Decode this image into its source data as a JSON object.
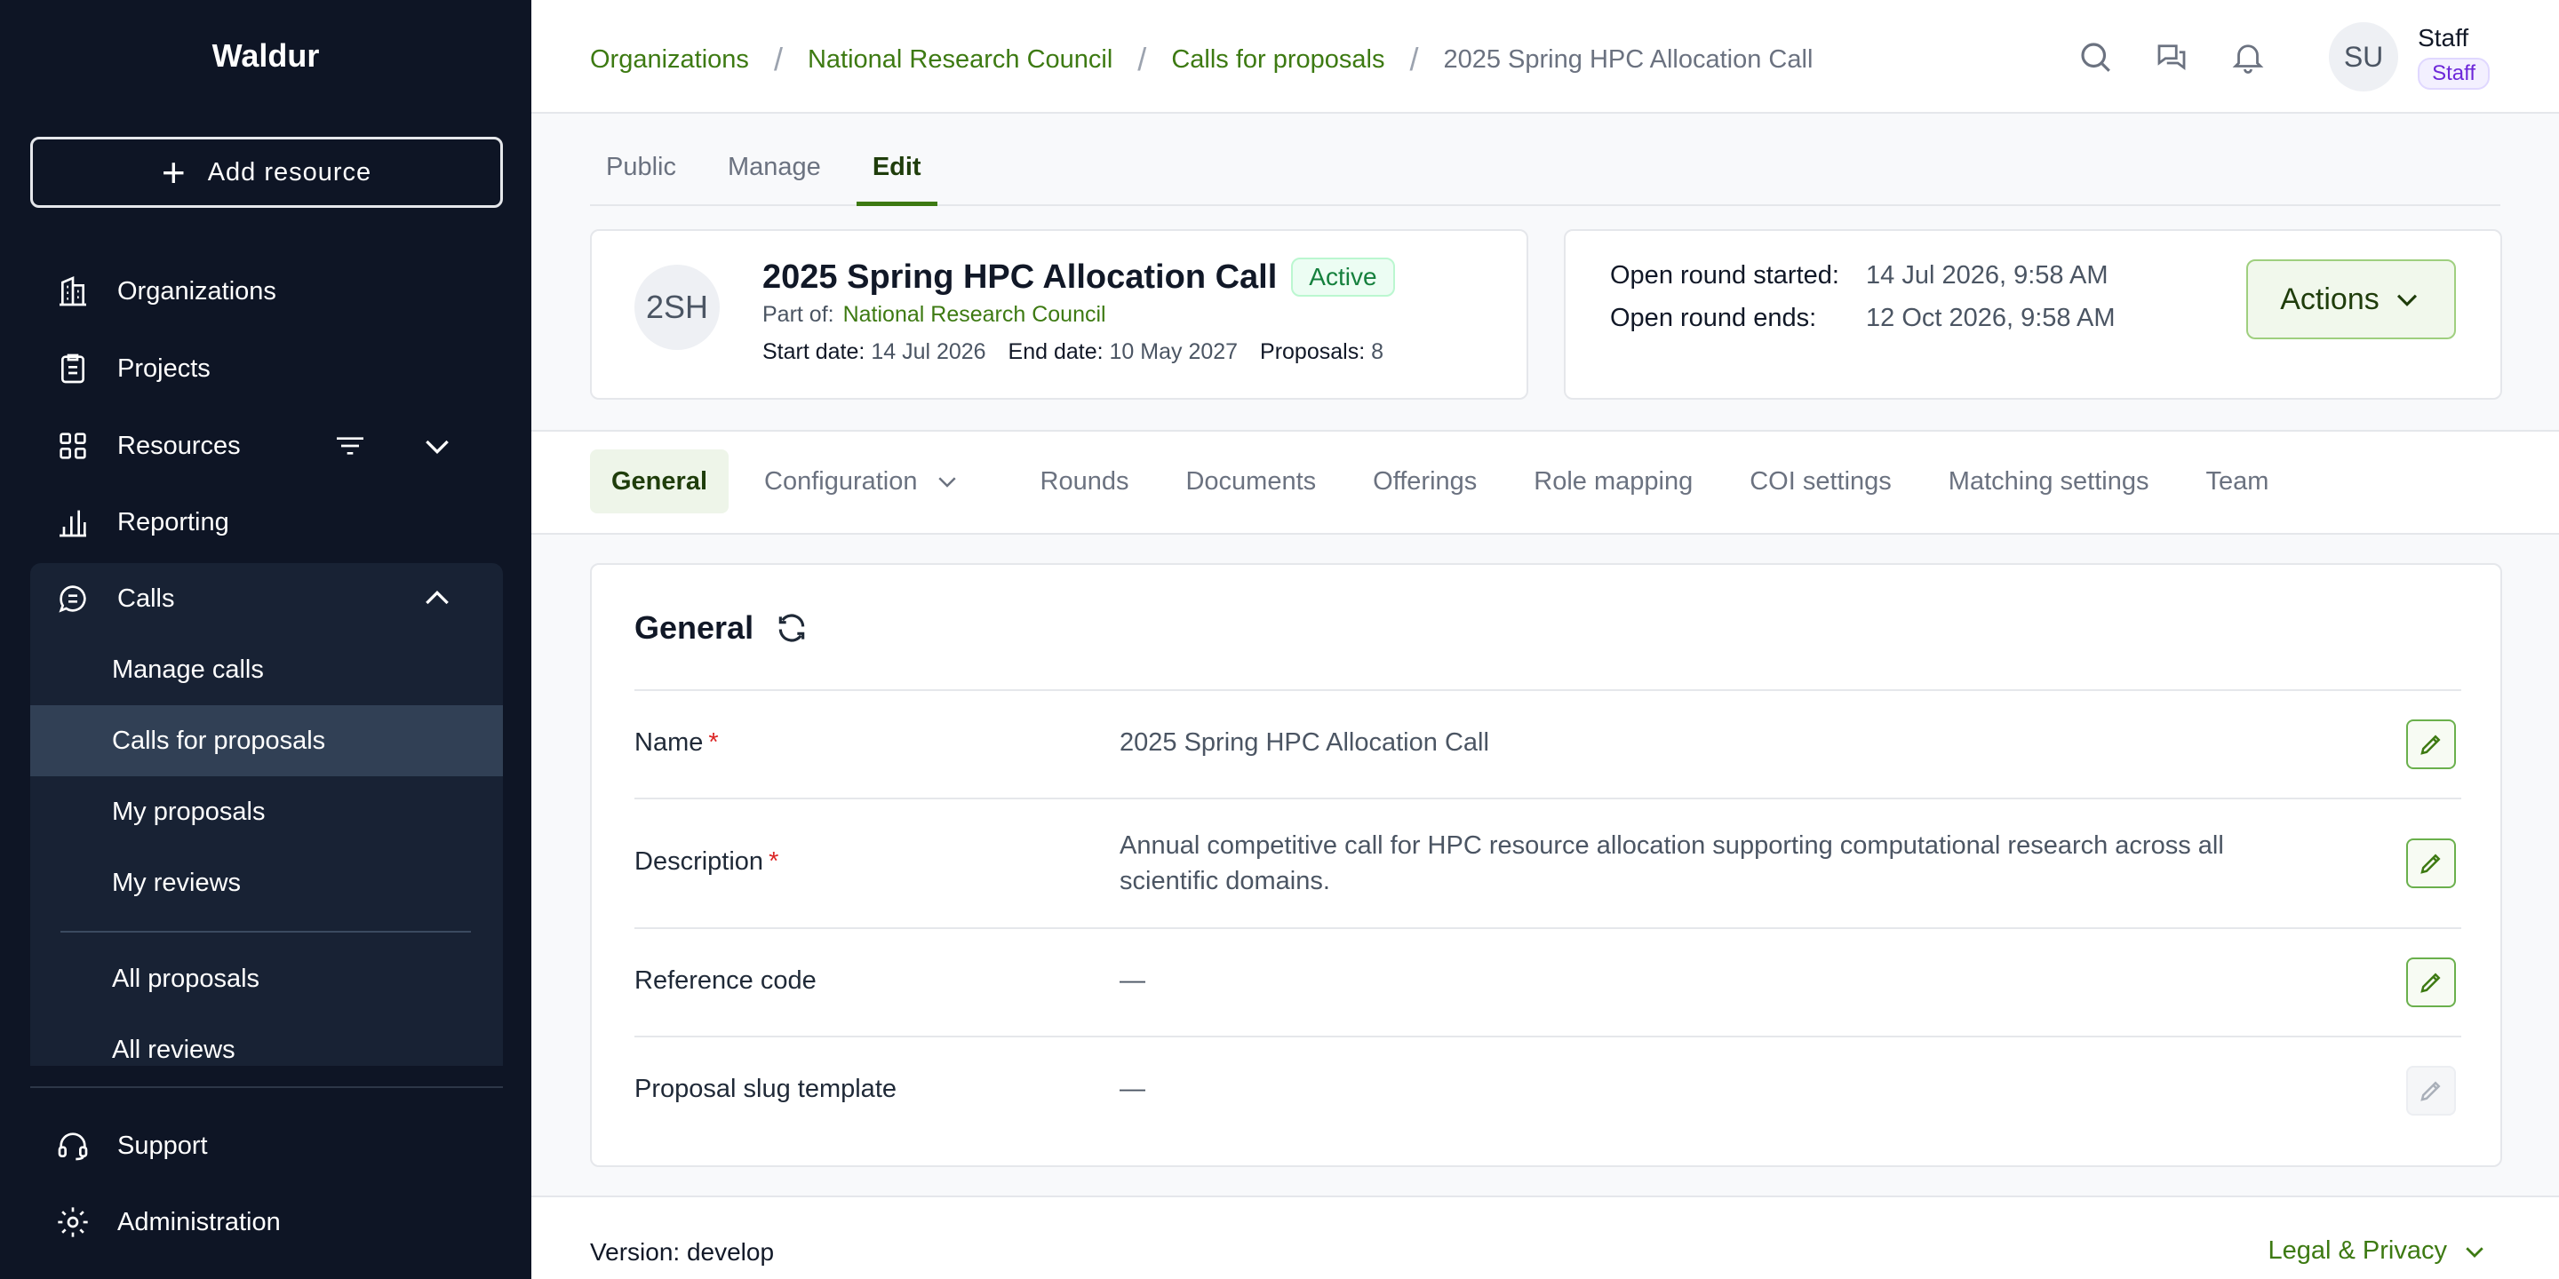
{
  "app": {
    "title": "Waldur"
  },
  "sidebar": {
    "add_resource": "Add resource",
    "items": [
      {
        "label": "Organizations",
        "icon": "building-icon"
      },
      {
        "label": "Projects",
        "icon": "clipboard-icon"
      },
      {
        "label": "Resources",
        "icon": "grid-icon"
      },
      {
        "label": "Reporting",
        "icon": "bar-chart-icon"
      },
      {
        "label": "Calls",
        "icon": "chat-list-icon"
      }
    ],
    "calls_sub": [
      "Manage calls",
      "Calls for proposals",
      "My proposals",
      "My reviews",
      "All proposals",
      "All reviews"
    ],
    "bottom": [
      {
        "label": "Support",
        "icon": "headset-icon"
      },
      {
        "label": "Administration",
        "icon": "gear-icon"
      }
    ]
  },
  "breadcrumbs": [
    "Organizations",
    "National Research Council",
    "Calls for proposals",
    "2025 Spring HPC Allocation Call"
  ],
  "user": {
    "initials": "SU",
    "name": "Staff",
    "role": "Staff"
  },
  "main_tabs": [
    "Public",
    "Manage",
    "Edit"
  ],
  "call": {
    "initials": "2SH",
    "title": "2025 Spring HPC Allocation Call",
    "status": "Active",
    "part_of_label": "Part of:",
    "part_of": "National Research Council",
    "start_label": "Start date:",
    "start_date": "14 Jul 2026",
    "end_label": "End date:",
    "end_date": "10 May 2027",
    "proposals_label": "Proposals:",
    "proposals": "8"
  },
  "round": {
    "started_label": "Open round started:",
    "started": "14 Jul 2026, 9:58 AM",
    "ends_label": "Open round ends:",
    "ends": "12 Oct 2026, 9:58 AM",
    "actions": "Actions"
  },
  "section_tabs": [
    "General",
    "Configuration",
    "Rounds",
    "Documents",
    "Offerings",
    "Role mapping",
    "COI settings",
    "Matching settings",
    "Team"
  ],
  "general": {
    "title": "General",
    "rows": [
      {
        "label": "Name",
        "value": "2025 Spring HPC Allocation Call"
      },
      {
        "label": "Description",
        "value": "Annual competitive call for HPC resource allocation supporting computational research across all scientific domains."
      },
      {
        "label": "Reference code",
        "value": "—"
      },
      {
        "label": "Proposal slug template",
        "value": "—"
      }
    ]
  },
  "footer": {
    "version": "Version: develop",
    "legal": "Legal & Privacy"
  },
  "colors": {
    "sidebar_bg": "#0e1525",
    "accent": "#3d7a12",
    "active_status": "#15803d"
  }
}
